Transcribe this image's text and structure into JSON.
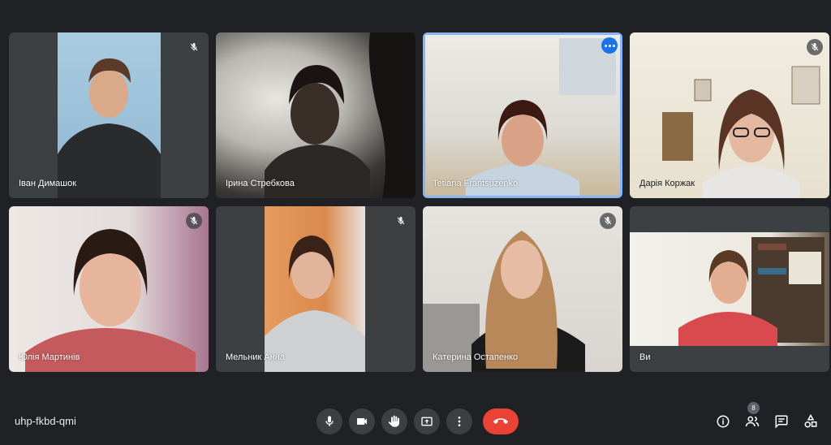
{
  "meeting": {
    "code": "uhp-fkbd-qmi"
  },
  "participants": [
    {
      "name": "Іван Димашок",
      "muted": true
    },
    {
      "name": "Ірина Стребкова",
      "muted": false
    },
    {
      "name": "Tetiana Frantsuzenko",
      "muted": false,
      "active": true
    },
    {
      "name": "Дарія Коржак",
      "muted": true
    },
    {
      "name": "Юлія Мартинів",
      "muted": true
    },
    {
      "name": "Мельник Анна",
      "muted": true
    },
    {
      "name": "Катерина Остапенко",
      "muted": true
    },
    {
      "name": "Ви",
      "muted": false
    }
  ],
  "controls": {
    "icons": [
      "microphone-icon",
      "camera-icon",
      "raise-hand-icon",
      "present-screen-icon",
      "more-options-icon",
      "end-call-icon"
    ]
  },
  "side_panel": {
    "people_count": "8",
    "icons": [
      "info-icon",
      "people-icon",
      "chat-icon",
      "activities-icon"
    ]
  },
  "colors": {
    "background": "#202124",
    "tile": "#3c4043",
    "active_border": "#8ab4f8",
    "end_call": "#ea4335"
  }
}
